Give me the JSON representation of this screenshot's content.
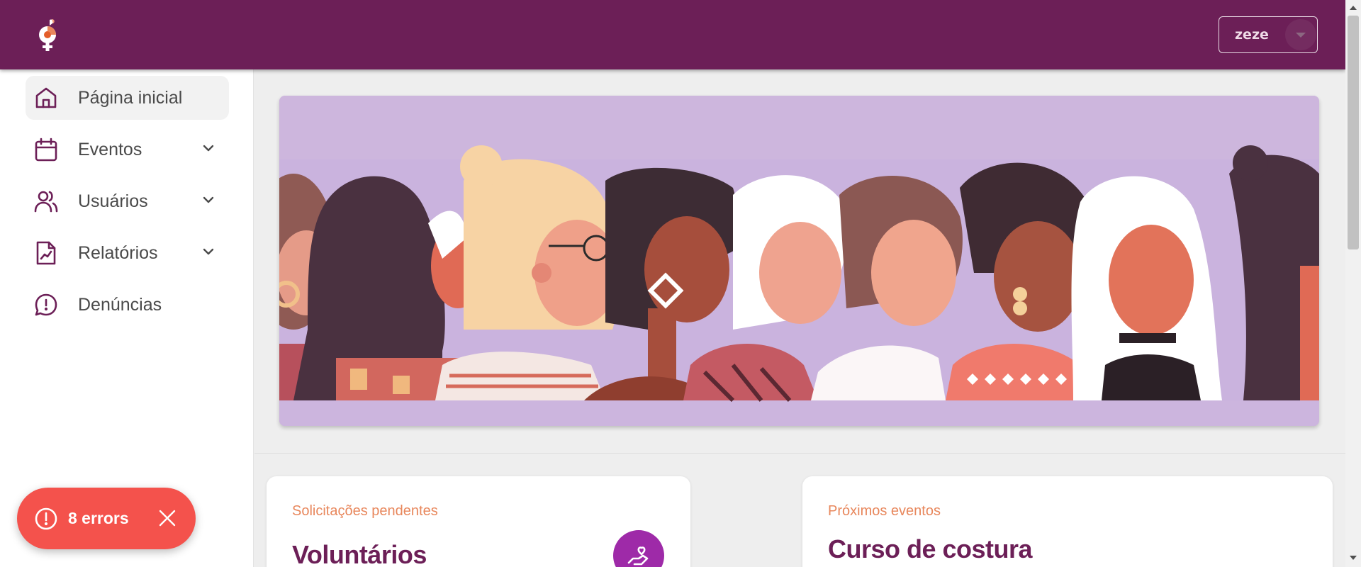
{
  "header": {
    "user_menu_label": "zeze"
  },
  "sidebar": {
    "items": [
      {
        "label": "Página inicial",
        "icon": "home-icon",
        "active": true
      },
      {
        "label": "Eventos",
        "icon": "calendar-icon",
        "expandable": true
      },
      {
        "label": "Usuários",
        "icon": "users-icon",
        "expandable": true
      },
      {
        "label": "Relatórios",
        "icon": "report-icon",
        "expandable": true
      },
      {
        "label": "Denúncias",
        "icon": "alert-chat-icon"
      }
    ]
  },
  "cards": [
    {
      "caption": "Solicitações pendentes",
      "title": "Voluntários",
      "icon": "volunteer-hand-heart-icon"
    },
    {
      "caption": "Próximos eventos",
      "title": "Curso de costura"
    }
  ],
  "toast": {
    "label": "8 errors",
    "icon": "error-circle-icon"
  },
  "colors": {
    "primary": "#6c1f57",
    "accent": "#e8875c",
    "banner_bg": "#cdb6dd",
    "toast_bg": "#f4524c",
    "badge": "#9e2aa8"
  }
}
